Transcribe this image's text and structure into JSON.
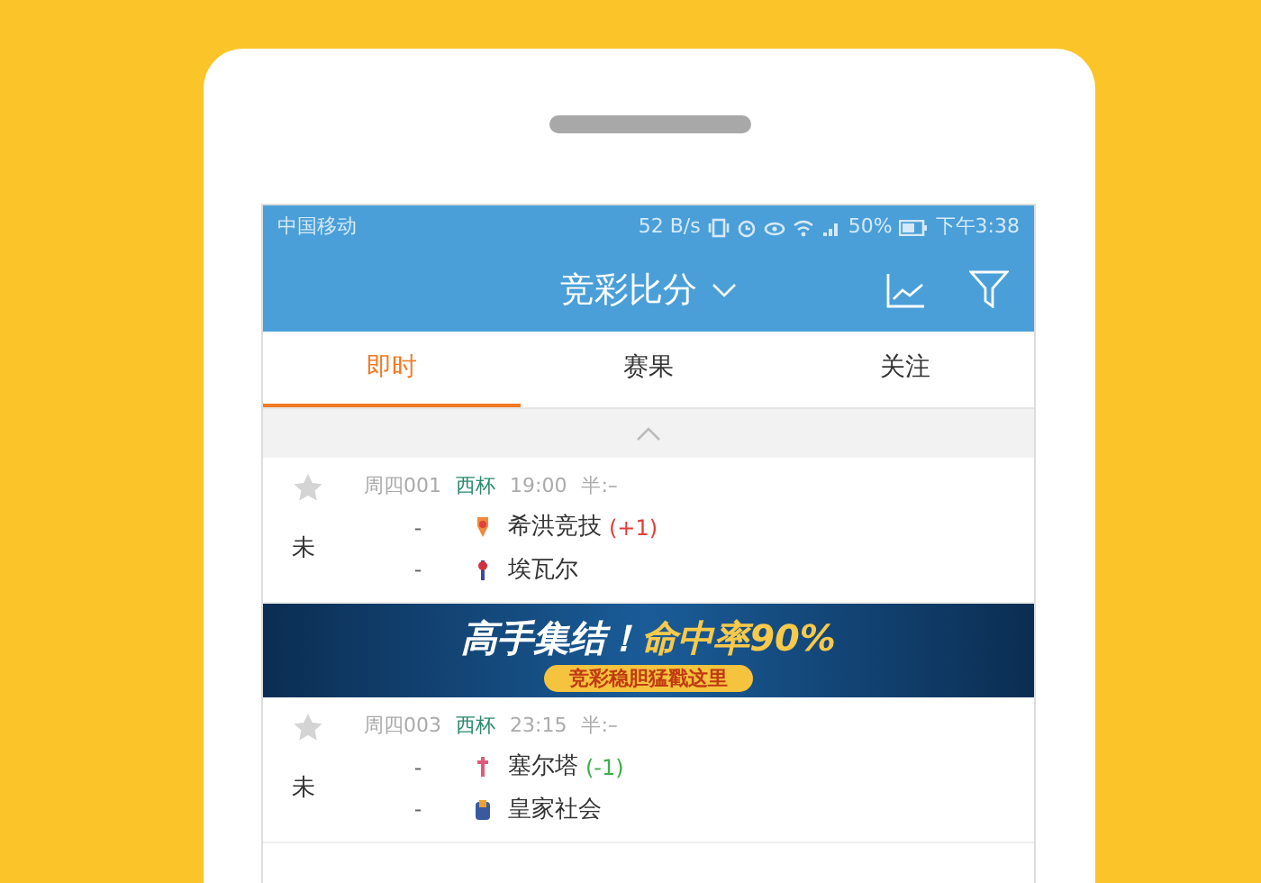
{
  "status_bar": {
    "carrier": "中国移动",
    "speed": "52 B/s",
    "battery": "50%",
    "time": "下午3:38"
  },
  "header": {
    "title": "竞彩比分"
  },
  "tabs": [
    {
      "label": "即时",
      "selected": true
    },
    {
      "label": "赛果",
      "selected": false
    },
    {
      "label": "关注",
      "selected": false
    }
  ],
  "matches": [
    {
      "starred": false,
      "code": "周四001",
      "league": "西杯",
      "time": "19:00",
      "half": "半:–",
      "status": "未",
      "teams": [
        {
          "score": "-",
          "name": "希洪竞技",
          "handicap": "(+1)",
          "color": "#e0403a"
        },
        {
          "score": "-",
          "name": "埃瓦尔"
        }
      ]
    },
    {
      "starred": false,
      "code": "周四003",
      "league": "西杯",
      "time": "23:15",
      "half": "半:–",
      "status": "未",
      "teams": [
        {
          "score": "-",
          "name": "塞尔塔",
          "handicap": "(-1)",
          "color": "#3fae4a"
        },
        {
          "score": "-",
          "name": "皇家社会"
        }
      ]
    }
  ],
  "banner": {
    "headline": "高手集结！",
    "highlight": "命中率90%",
    "button": "竞彩稳胆猛戳这里"
  }
}
